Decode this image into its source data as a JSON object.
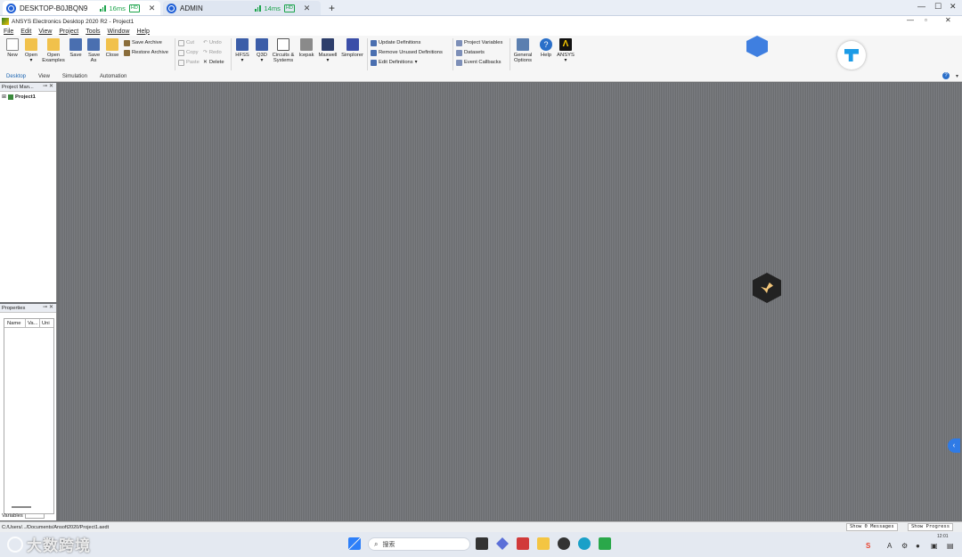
{
  "remote_tabs": [
    {
      "name": "DESKTOP-B0JBQN9",
      "latency": "16ms",
      "quality": "HD"
    },
    {
      "name": "ADMIN",
      "latency": "14ms",
      "quality": "HD"
    }
  ],
  "app": {
    "title": "ANSYS Electronics Desktop 2020 R2 - Project1",
    "menu": [
      "File",
      "Edit",
      "View",
      "Project",
      "Tools",
      "Window",
      "Help"
    ]
  },
  "ribbon": {
    "file_group": {
      "new": "New",
      "open": "Open",
      "open_examples": "Open Examples",
      "save": "Save",
      "save_as": "Save As",
      "close": "Close",
      "save_archive": "Save Archive",
      "restore_archive": "Restore Archive"
    },
    "edit_group": {
      "cut": "Cut",
      "copy": "Copy",
      "paste": "Paste",
      "undo": "Undo",
      "redo": "Redo",
      "delete": "Delete"
    },
    "design_group": {
      "hfss": "HFSS",
      "q3d": "Q3D",
      "circuits": "Circuits & Systems",
      "icepak": "Icepak",
      "maxwell": "Maxwell",
      "simplorer": "Simplorer"
    },
    "defs_group": {
      "update": "Update Definitions",
      "remove_unused": "Remove Unused Definitions",
      "edit": "Edit Definitions"
    },
    "vars_group": {
      "project_variables": "Project Variables",
      "datasets": "Datasets",
      "event_callbacks": "Event Callbacks"
    },
    "general_options": "General Options",
    "help": "Help",
    "ansys": "ANSYS"
  },
  "ribbon_tabs": [
    "Desktop",
    "View",
    "Simulation",
    "Automation"
  ],
  "project_manager": {
    "title": "Project Man...",
    "root": "Project1"
  },
  "properties": {
    "title": "Properties",
    "columns": [
      "Name",
      "Va...",
      "Uni"
    ],
    "footer_tab": "Variables"
  },
  "status": {
    "path": "C:/Users/.../Documents/Ansoft2020/Project1.aedt",
    "messages_btn": "Show 0 Messages",
    "progress_btn": "Show Progress"
  },
  "taskbar": {
    "search_placeholder": "搜索",
    "watermark": "大数跨境",
    "clock": "12:01"
  },
  "colors": {
    "workspace": "#6e7073",
    "accent": "#1a63b0",
    "latency": "#1aa34a"
  }
}
